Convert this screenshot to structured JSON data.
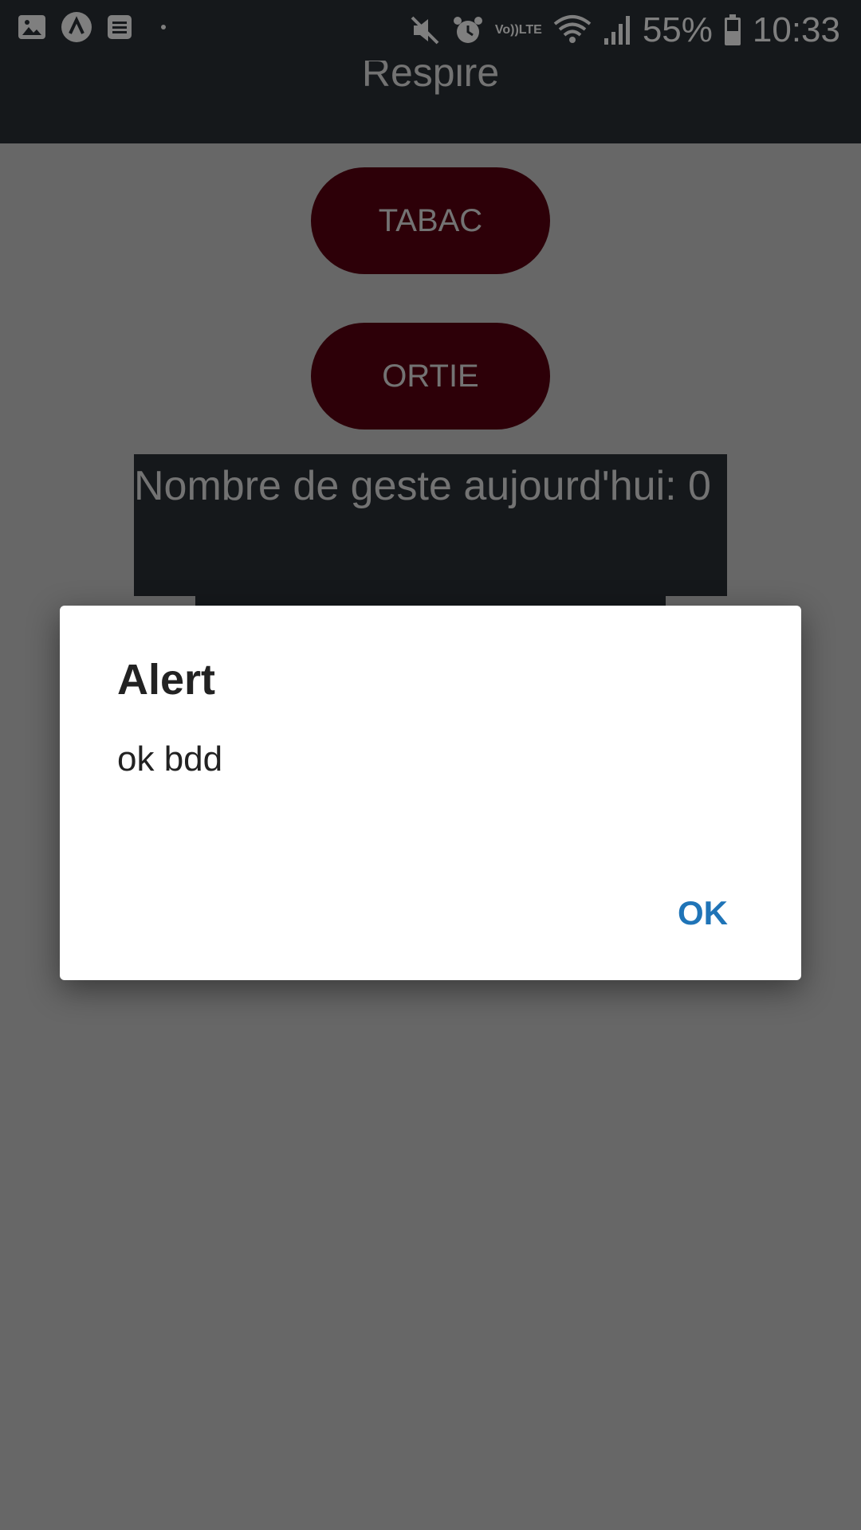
{
  "status_bar": {
    "battery_percent": "55%",
    "time": "10:33",
    "volte_top": "Vo))",
    "volte_bottom": "LTE",
    "icons": [
      "gallery-icon",
      "app-a-icon",
      "notes-icon",
      "notification-dot-icon",
      "mute-icon",
      "alarm-icon",
      "volte-icon",
      "wifi-icon",
      "signal-icon",
      "battery-icon"
    ]
  },
  "app_bar": {
    "title": "Respire"
  },
  "buttons": {
    "tabac_label": "TABAC",
    "ortie_label": "ORTIE"
  },
  "counter": {
    "label": "Nombre de geste aujourd'hui: 0"
  },
  "dialog": {
    "title": "Alert",
    "message": "ok bdd",
    "ok_label": "OK"
  },
  "colors": {
    "app_bar": "#2a3037",
    "pill": "#5a0010",
    "ok_text": "#1f74b7",
    "dialog_bg": "#ffffff"
  }
}
